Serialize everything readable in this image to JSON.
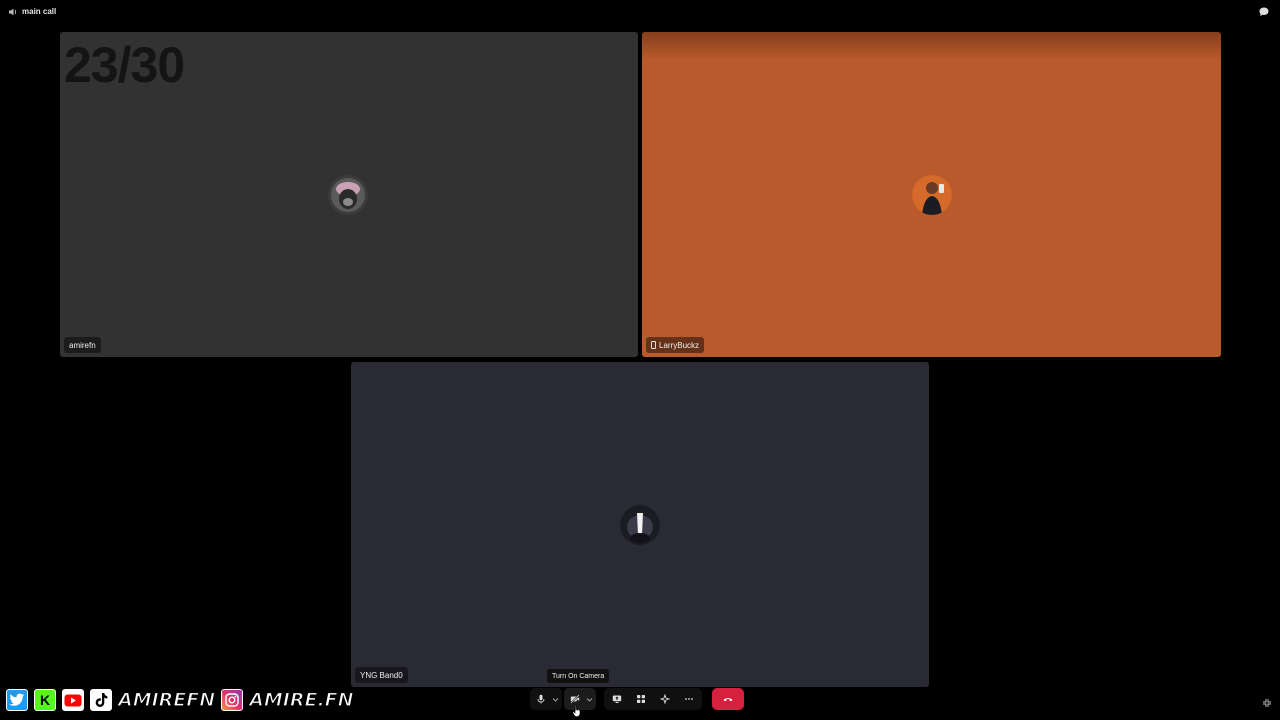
{
  "window": {
    "title": "main call",
    "title_icon": "speaker-icon",
    "chat_icon": "chat-bubble-icon"
  },
  "overlay": {
    "counter": "23/30"
  },
  "participants": [
    {
      "name": "amirefn",
      "tile_color": "#323232",
      "mobile": false
    },
    {
      "name": "LarryBuckz",
      "tile_color": "#b95a2c",
      "mobile": true
    },
    {
      "name": "YNG Band0",
      "tile_color": "#2a2a35",
      "mobile": false
    }
  ],
  "tooltip": {
    "text": "Turn On Camera"
  },
  "controls": {
    "mic_icon": "microphone-icon",
    "camera_icon": "camera-off-icon",
    "screen_share_icon": "screen-share-icon",
    "activities_icon": "grid-icon",
    "soundboard_icon": "sparkle-icon",
    "more_icon": "ellipsis-icon",
    "hangup_icon": "phone-hangup-icon",
    "hangup_color": "#d6203f"
  },
  "socials": {
    "handle_1": "AMIREFN",
    "handle_2": "AMIRE.FN",
    "icons": [
      "twitter-icon",
      "kick-icon",
      "youtube-icon",
      "tiktok-icon",
      "instagram-icon"
    ]
  }
}
